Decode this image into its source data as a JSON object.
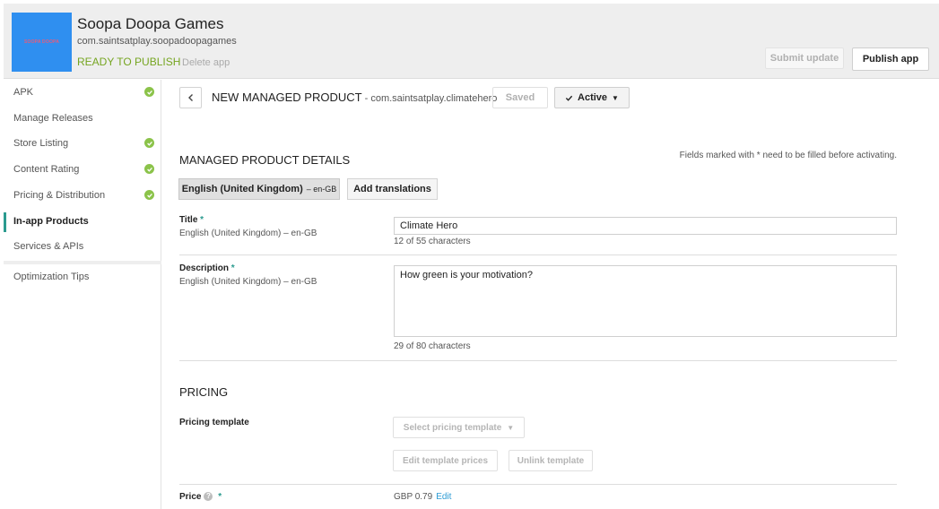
{
  "app": {
    "logo_text": "SOOPA DOOPA",
    "title": "Soopa Doopa Games",
    "package": "com.saintsatplay.soopadoopagames",
    "status": "READY TO PUBLISH",
    "delete_label": "Delete app",
    "submit_label": "Submit update",
    "publish_label": "Publish app",
    "accent_color": "#76a521",
    "logo_color": "#2f8ff0"
  },
  "sidebar": {
    "items": [
      {
        "label": "APK",
        "checked": true
      },
      {
        "label": "Manage Releases",
        "checked": false
      },
      {
        "label": "Store Listing",
        "checked": true
      },
      {
        "label": "Content Rating",
        "checked": true
      },
      {
        "label": "Pricing & Distribution",
        "checked": true
      },
      {
        "label": "In-app Products",
        "checked": false,
        "active": true
      },
      {
        "label": "Services & APIs",
        "checked": false
      },
      {
        "label": "Optimization Tips",
        "checked": false
      }
    ],
    "check_icon": "check-circle-icon",
    "active_color": "#2b9b8f"
  },
  "product": {
    "title": "NEW MANAGED PRODUCT",
    "separator": " - ",
    "package": "com.saintsatplay.climatehero",
    "saved_label": "Saved",
    "status_label": "Active"
  },
  "details": {
    "section_title": "MANAGED PRODUCT DETAILS",
    "fields_note": "Fields marked with * need to be filled before activating.",
    "lang_tab_label": "English (United Kingdom)",
    "lang_tab_code": "– en-GB",
    "add_translations_label": "Add translations",
    "title_label": "Title",
    "title_sub": "English (United Kingdom) – en-GB",
    "title_value": "Climate Hero",
    "title_count": "12 of 55 characters",
    "desc_label": "Description",
    "desc_sub": "English (United Kingdom) – en-GB",
    "desc_value": "How green is your motivation?",
    "desc_count": "29 of 80 characters",
    "required_mark": "*"
  },
  "pricing": {
    "section_title": "PRICING",
    "template_label": "Pricing template",
    "select_label": "Select pricing template",
    "edit_template_label": "Edit template prices",
    "unlink_label": "Unlink template",
    "price_label": "Price",
    "price_value": "GBP 0.79",
    "edit_label": "Edit",
    "help_icon": "?"
  }
}
